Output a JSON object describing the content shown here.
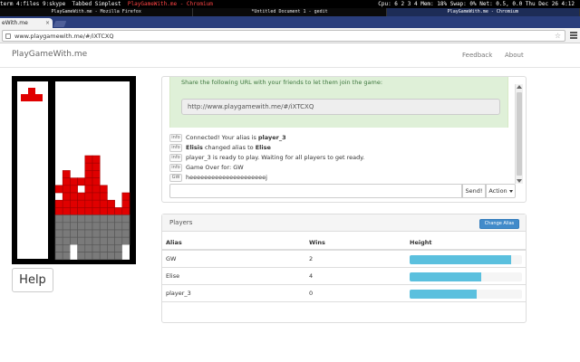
{
  "system": {
    "workspaces": "term 4:files 9:skype",
    "tabbed_simplest": "Tabbed Simplest",
    "active_window": "PlayGameWith.me - Chromium",
    "status": "Cpu:  6  2  3  4   Mem: 18%  Swap: 0%  Net: 0.5, 0.0  Thu Dec 26 4:12"
  },
  "tasklist": [
    "PlayGameWith.me - Mozilla Firefox",
    "*Untitled Document 1 - gedit",
    "PlayGameWith.me - Chromium"
  ],
  "browser": {
    "tab_title": "eWith.me",
    "tab_close": "×",
    "url": "www.playgamewith.me/#/iXTCXQ",
    "star": "☆"
  },
  "navbar": {
    "brand": "PlayGameWith.me",
    "feedback": "Feedback",
    "about": "About"
  },
  "game": {
    "cols": 10,
    "rows": 20,
    "colors": {
      "red": "#e00000",
      "gray": "#7a7a7a",
      "white": "#ffffff",
      "black": "#000000"
    },
    "help_label": "Help"
  },
  "chat": {
    "share_text": "Share the following URL with your friends to let them join the game:",
    "share_url": "http://www.playgamewith.me/#/iXTCXQ",
    "messages": [
      {
        "tag": "info",
        "pre": "Connected! Your alias is ",
        "bold": "player_3",
        "post": ""
      },
      {
        "tag": "info",
        "pre": "",
        "bold": "Elisis",
        "post": " changed alias to ",
        "bold2": "Elise"
      },
      {
        "tag": "info",
        "pre": "player_3 is ready to play. Waiting for all players to get ready.",
        "bold": "",
        "post": ""
      },
      {
        "tag": "info",
        "pre": "Game Over for: GW",
        "bold": "",
        "post": ""
      },
      {
        "tag": "GW",
        "pre": "heeeeeeeeeeeeeeeeeeeeej",
        "bold": "",
        "post": ""
      }
    ],
    "send_label": "Send!",
    "action_label": "Action"
  },
  "players": {
    "title": "Players",
    "change_alias_label": "Change Alias",
    "columns": {
      "alias": "Alias",
      "wins": "Wins",
      "height": "Height"
    },
    "rows": [
      {
        "alias": "GW",
        "wins": "2",
        "height_fraction": 0.9
      },
      {
        "alias": "Elise",
        "wins": "4",
        "height_fraction": 0.64
      },
      {
        "alias": "player_3",
        "wins": "0",
        "height_fraction": 0.6
      }
    ]
  }
}
